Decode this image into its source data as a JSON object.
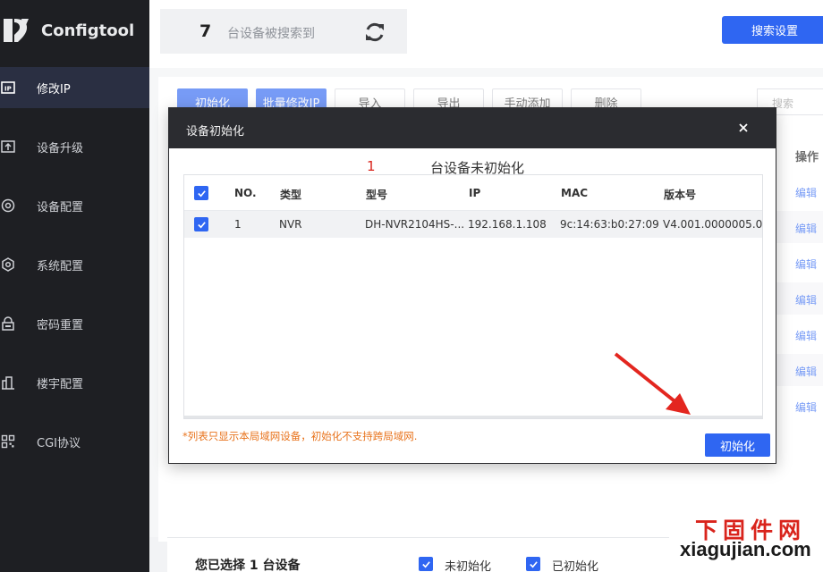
{
  "app": {
    "name": "Configtool"
  },
  "sidebar": {
    "items": [
      {
        "label": "修改IP",
        "icon": "ip-icon",
        "active": true
      },
      {
        "label": "设备升级",
        "icon": "upload-icon"
      },
      {
        "label": "设备配置",
        "icon": "target-icon"
      },
      {
        "label": "系统配置",
        "icon": "hexagon-gear-icon"
      },
      {
        "label": "密码重置",
        "icon": "lock-icon"
      },
      {
        "label": "楼宇配置",
        "icon": "building-icon"
      },
      {
        "label": "CGI协议",
        "icon": "grid-icon"
      }
    ]
  },
  "header": {
    "device_count": "7",
    "count_text": "台设备被搜索到",
    "search_setting": "搜索设置"
  },
  "toolbar": {
    "buttons": [
      "初始化",
      "批量修改IP",
      "导入",
      "导出",
      "手动添加",
      "删除"
    ],
    "search_placeholder": "搜索"
  },
  "table_behind": {
    "op_header": "操作",
    "edit_label": "编辑"
  },
  "modal": {
    "title": "设备初始化",
    "uninit_count": "1",
    "uninit_text": "台设备未初始化",
    "columns": [
      "NO.",
      "类型",
      "型号",
      "IP",
      "MAC",
      "版本号"
    ],
    "rows": [
      {
        "no": "1",
        "type": "NVR",
        "model": "DH-NVR2104HS-...",
        "ip": "192.168.1.108",
        "mac": "9c:14:63:b0:27:09",
        "version": "V4.001.0000005.0"
      }
    ],
    "note": "*列表只显示本局域网设备，初始化不支持跨局域网.",
    "init_button": "初始化"
  },
  "bottombar": {
    "selected_text": "您已选择 1 台设备",
    "filter_uninit": "未初始化",
    "filter_init": "已初始化"
  },
  "watermark": {
    "cn": "下固件网",
    "en": "xiagujian.com"
  },
  "colors": {
    "accent": "#2f66f2",
    "sidebar_bg": "#1e1f23",
    "warning": "#e8731c",
    "red": "#d9241c"
  }
}
